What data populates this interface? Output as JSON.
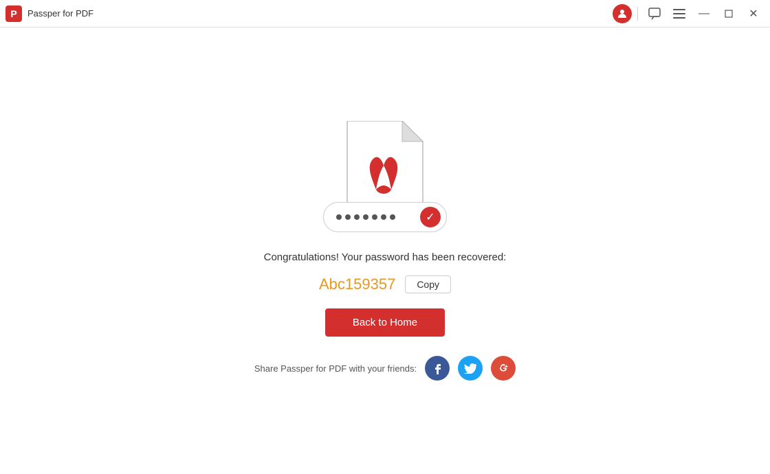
{
  "titlebar": {
    "app_name": "Passper for PDF",
    "app_icon_letter": "P"
  },
  "content": {
    "congrats_text": "Congratulations! Your password has been recovered:",
    "password": "Abc159357",
    "copy_label": "Copy",
    "back_home_label": "Back to Home",
    "share_label": "Share Passper for PDF with your friends:",
    "dots_count": 7,
    "checkmark": "✓"
  },
  "social": {
    "facebook_letter": "f",
    "twitter_letter": "t",
    "google_letter": "g+"
  },
  "titlebar_buttons": {
    "minimize": "—",
    "maximize": "□",
    "close": "✕"
  }
}
